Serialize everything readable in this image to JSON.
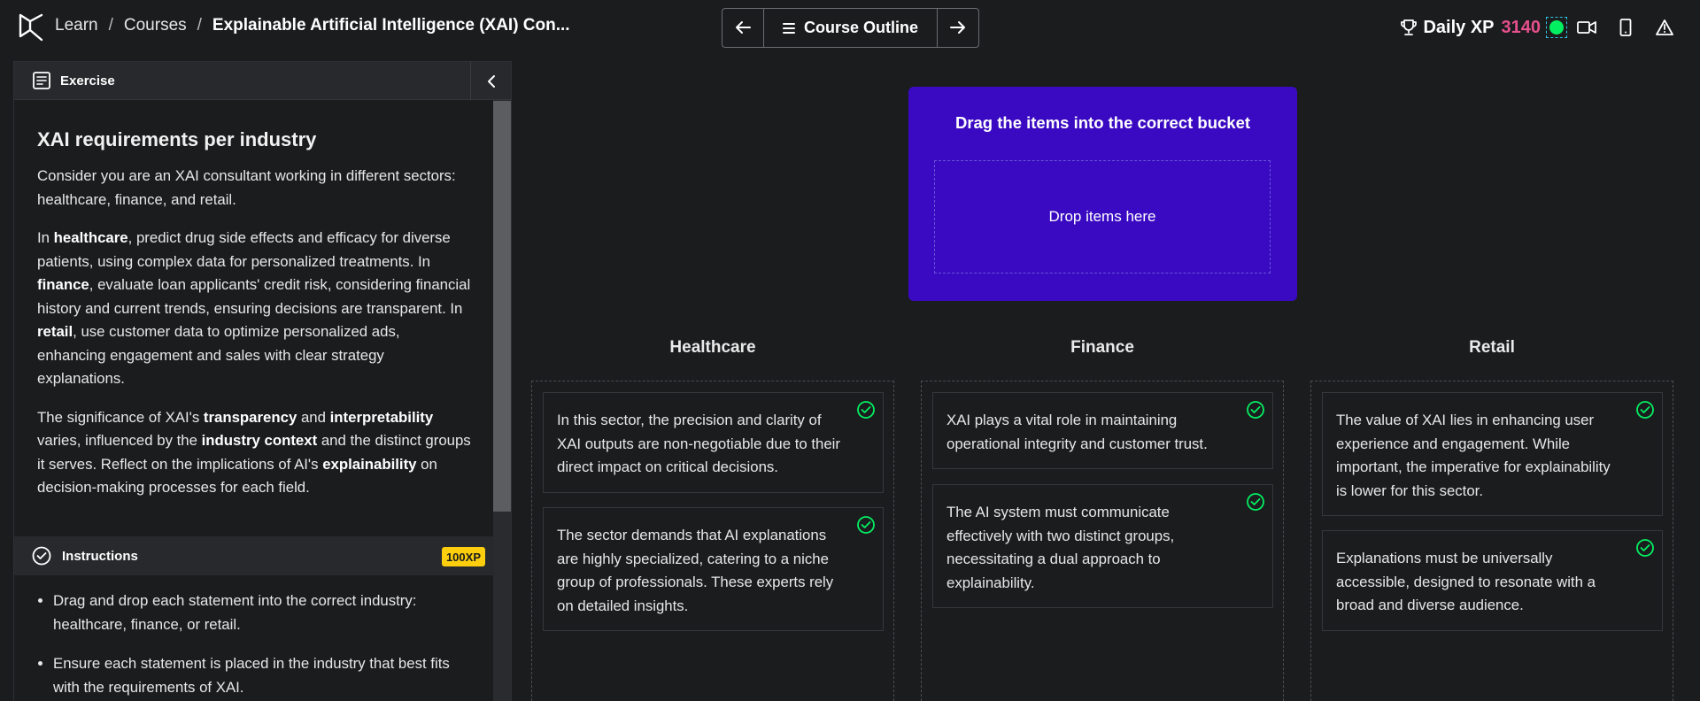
{
  "breadcrumbs": {
    "learn": "Learn",
    "sep1": "/",
    "courses": "Courses",
    "sep2": "/",
    "current": "Explainable Artificial Intelligence (XAI) Con..."
  },
  "outline": {
    "label": "Course Outline"
  },
  "xp": {
    "label": "Daily XP",
    "value": "3140"
  },
  "exercise_panel": {
    "header": "Exercise",
    "title": "XAI requirements per industry",
    "p1": "Consider you are an XAI consultant working in different sectors: healthcare, finance, and retail.",
    "p2": {
      "t1": "In ",
      "b1": "healthcare",
      "t2": ", predict drug side effects and efficacy for diverse patients, using complex data for personalized treatments. In ",
      "b2": "finance",
      "t3": ", evaluate loan applicants' credit risk, considering financial history and current trends, ensuring decisions are transparent. In ",
      "b3": "retail",
      "t4": ", use customer data to optimize personalized ads, enhancing engagement and sales with clear strategy explanations."
    },
    "p3": {
      "t1": "The significance of XAI's ",
      "b1": "transparency",
      "t2": " and ",
      "b2": "interpretability",
      "t3": " varies, influenced by the ",
      "b3": "industry context",
      "t4": " and the distinct groups it serves. Reflect on the implications of AI's ",
      "b4": "explainability",
      "t5": " on decision-making processes for each field."
    }
  },
  "instructions": {
    "header": "Instructions",
    "badge": "100XP",
    "items": [
      "Drag and drop each statement into the correct industry: healthcare, finance, or retail.",
      "Ensure each statement is placed in the industry that best fits with the requirements of XAI."
    ]
  },
  "dropzone": {
    "title": "Drag the items into the correct bucket",
    "placeholder": "Drop items here"
  },
  "buckets": [
    {
      "name": "Healthcare",
      "items": [
        "In this sector, the precision and clarity of XAI outputs are non-negotiable due to their direct impact on critical decisions.",
        "The sector demands that AI explanations are highly specialized, catering to a niche group of professionals. These experts rely on detailed insights."
      ]
    },
    {
      "name": "Finance",
      "items": [
        "XAI plays a vital role in maintaining operational integrity and customer trust.",
        "The AI system must communicate effectively with two distinct groups, necessitating a dual approach to explainability."
      ]
    },
    {
      "name": "Retail",
      "items": [
        "The value of XAI lies in enhancing user experience and engagement. While important, the imperative for explainability is lower for this sector.",
        "Explanations must be universally accessible, designed to resonate with a broad and diverse audience."
      ]
    }
  ],
  "colors": {
    "background": "#1b1c1e",
    "accent_purple": "#3a0ac2",
    "xp_pink": "#e5508d",
    "success_green": "#03ef62",
    "badge_yellow": "#fcce0d"
  },
  "icons": [
    "datacamp-logo-icon",
    "arrow-left-icon",
    "menu-icon",
    "arrow-right-icon",
    "trophy-icon",
    "video-icon",
    "mobile-icon",
    "warning-icon",
    "exercise-icon",
    "chevron-left-icon",
    "check-circle-icon"
  ]
}
